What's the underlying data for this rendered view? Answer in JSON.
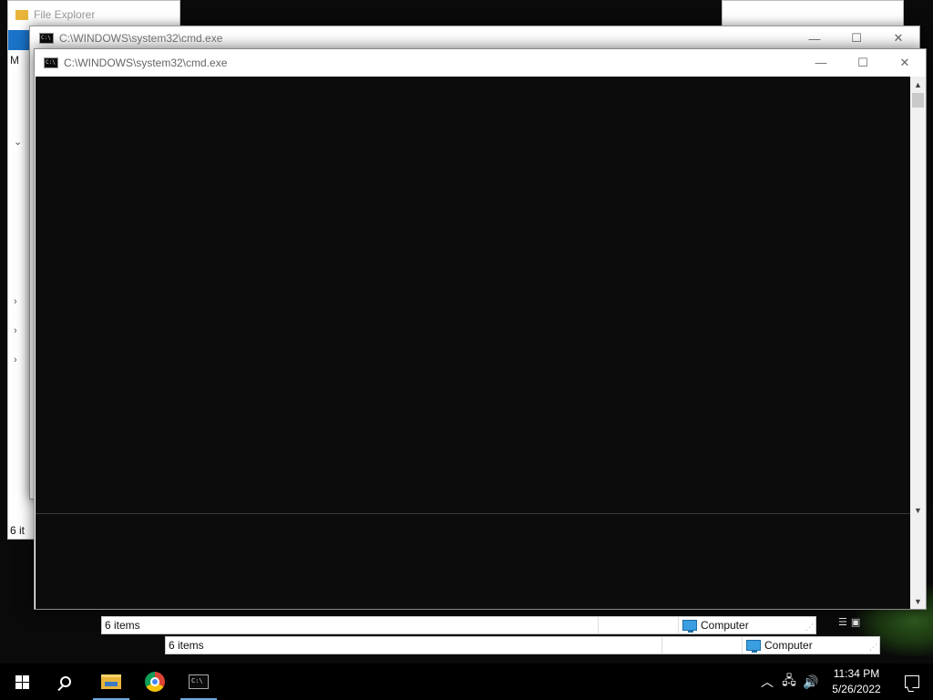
{
  "windows": {
    "cmd_back": {
      "title": "C:\\WINDOWS\\system32\\cmd.exe"
    },
    "cmd_front": {
      "title": "C:\\WINDOWS\\system32\\cmd.exe"
    },
    "explorer_background": {
      "title": "File Explorer",
      "status_fragment": "6 it",
      "menu_letter": "M"
    }
  },
  "window_controls": {
    "minimize_glyph": "—",
    "maximize_glyph": "☐",
    "close_glyph": "✕"
  },
  "status_bars": [
    {
      "item_count": "6 items",
      "location": "Computer"
    },
    {
      "item_count": "6 items",
      "location": "Computer"
    }
  ],
  "taskbar": {
    "clock": {
      "time": "11:34 PM",
      "date": "5/26/2022"
    },
    "tray_icons": [
      "chevron-up-icon",
      "network-icon",
      "volume-icon"
    ]
  }
}
